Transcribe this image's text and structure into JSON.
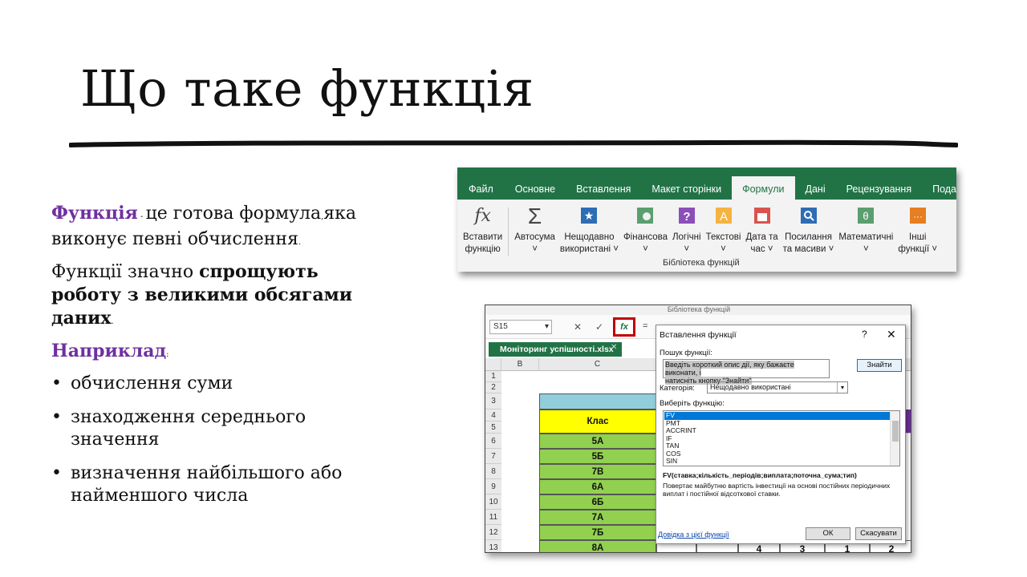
{
  "slide": {
    "title": "Що таке функція",
    "p1_term": "Функція",
    "p1_dash": " - ",
    "p1_rest1": "це готова формула",
    "p1_comma": ",",
    "p1_rest2": "яка виконує певні обчислення",
    "p1_end": ".",
    "p2_start": "Функції значно ",
    "p2_bold": "спрощують роботу з великими обсягами даних",
    "p2_end": ".",
    "p3_term": "Наприклад",
    "p3_end": ":",
    "bullets": [
      "обчислення суми",
      "знаходження середнього значення",
      "визначення найбільшого або найменшого числа"
    ],
    "colors": {
      "accent": "#7030a0",
      "excel_green": "#217346",
      "class_fill": "#92d050",
      "highlight_red": "#c00000"
    }
  },
  "ribbon": {
    "tabs": [
      "Файл",
      "Основне",
      "Вставлення",
      "Макет сторінки",
      "Формули",
      "Дані",
      "Рецензування",
      "Подання"
    ],
    "active_tab": "Формули",
    "buttons": [
      {
        "l1": "Вставити",
        "l2": "функцію",
        "icon": "insert-function-icon"
      },
      {
        "l1": "Автосума",
        "l2": "˅",
        "icon": "autosum-icon"
      },
      {
        "l1": "Нещодавно",
        "l2": "використані ˅",
        "icon": "recent-icon"
      },
      {
        "l1": "Фінансова",
        "l2": "˅",
        "icon": "financial-icon"
      },
      {
        "l1": "Логічні",
        "l2": "˅",
        "icon": "logical-icon"
      },
      {
        "l1": "Текстові",
        "l2": "˅",
        "icon": "text-icon"
      },
      {
        "l1": "Дата та",
        "l2": "час ˅",
        "icon": "datetime-icon"
      },
      {
        "l1": "Посилання",
        "l2": "та масиви ˅",
        "icon": "lookup-icon"
      },
      {
        "l1": "Математичні",
        "l2": "˅",
        "icon": "math-icon"
      },
      {
        "l1": "Інші",
        "l2": "функції ˅",
        "icon": "more-functions-icon"
      }
    ],
    "group_label": "Бібліотека функцій"
  },
  "excel": {
    "top_strip": "Бібліотека функцій",
    "name_box": "S15",
    "name_box_arrow": "▾",
    "fx_cancel": "✕",
    "fx_enter": "✓",
    "fx_label": "fx",
    "fx_eq": "=",
    "workbook_tab": "Моніторинг успішності.xlsx",
    "workbook_close": "✕",
    "col_headers": [
      "B",
      "C"
    ],
    "row_numbers": [
      "1",
      "2",
      "3",
      "4",
      "5",
      "6",
      "7",
      "8",
      "9",
      "10",
      "11",
      "12",
      "13"
    ],
    "class_header": "Клас",
    "classes": [
      "5А",
      "5Б",
      "7В",
      "6А",
      "6Б",
      "7А",
      "7Б",
      "8А"
    ],
    "bottom_values": [
      "4",
      "3",
      "1",
      "2"
    ],
    "dialog": {
      "title": "Вставлення функції",
      "help_q": "?",
      "close": "✕",
      "search_label": "Пошук функції:",
      "search_text_1": "Введіть короткий опис дії, яку бажаєте виконати, і",
      "search_text_2": "натисніть кнопку \"Знайти\"",
      "find_button": "Знайти",
      "category_label": "Категорія:",
      "category_value": "Нещодавно використані",
      "category_arrow": "▾",
      "function_label": "Виберіть функцію:",
      "functions": [
        "FV",
        "PMT",
        "ACCRINT",
        "IF",
        "TAN",
        "COS",
        "SIN"
      ],
      "selected": "FV",
      "signature": "FV(ставка;кількість_періодів;виплата;поточна_сума;тип)",
      "description": "Повертає майбутню вартість інвестиції на основі постійних періодичних виплат і постійної відсоткової ставки.",
      "help_link": "Довідка з цієї функції",
      "ok": "ОК",
      "cancel": "Скасувати"
    }
  }
}
